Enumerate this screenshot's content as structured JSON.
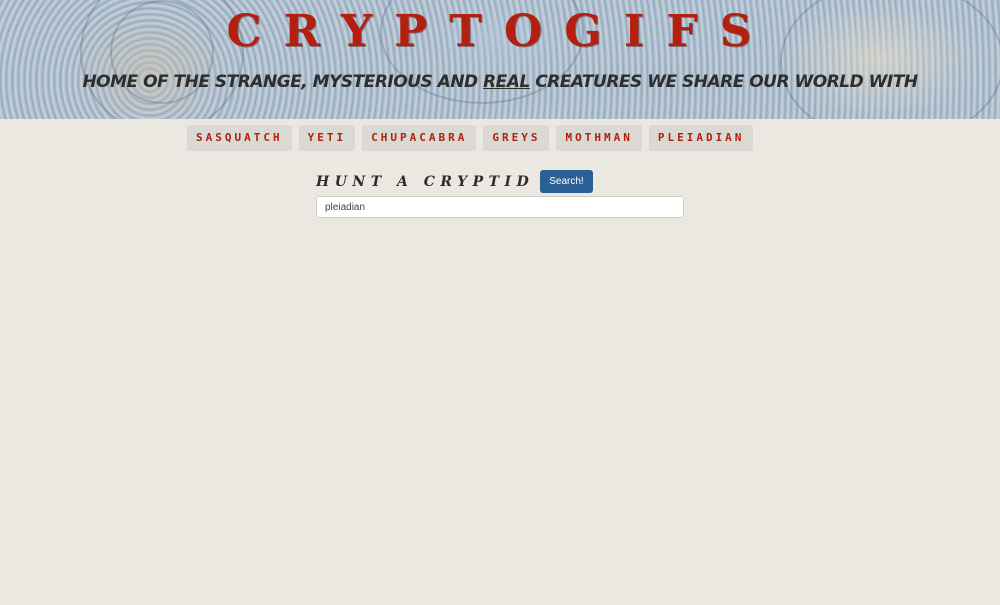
{
  "header": {
    "title": "CRYPTOGIFS",
    "tagline_before": "HOME OF THE STRANGE, MYSTERIOUS AND ",
    "tagline_emphasis": "REAL",
    "tagline_after": " CREATURES WE SHARE OUR WORLD WITH"
  },
  "nav": {
    "items": [
      {
        "label": "SASQUATCH"
      },
      {
        "label": "YETI"
      },
      {
        "label": "CHUPACABRA"
      },
      {
        "label": "GREYS"
      },
      {
        "label": "MOTHMAN"
      },
      {
        "label": "PLEIADIAN"
      }
    ]
  },
  "search": {
    "heading": "HUNT A CRYPTID",
    "button_label": "Search!",
    "value": "pleiadian"
  },
  "colors": {
    "accent_red": "#b3200f",
    "button_blue": "#2b6097",
    "page_background": "#ebe8e1"
  }
}
